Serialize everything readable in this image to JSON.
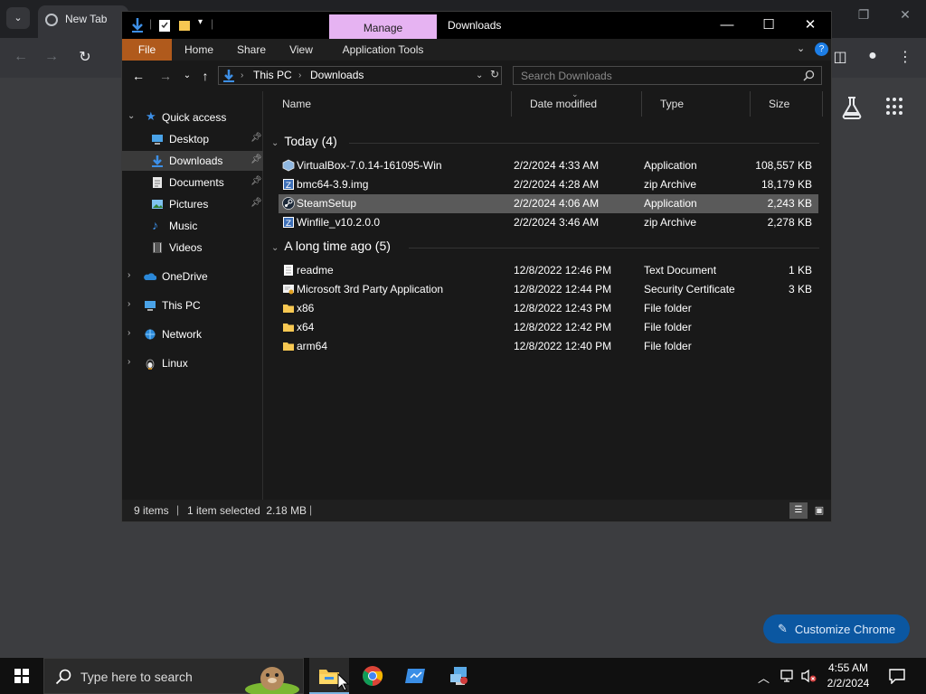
{
  "chrome": {
    "tab_title": "New Tab",
    "customize_label": "Customize Chrome"
  },
  "explorer": {
    "manage_label": "Manage",
    "window_title": "Downloads",
    "ribbon_tabs": [
      "File",
      "Home",
      "Share",
      "View",
      "Application Tools"
    ],
    "address": {
      "segments": [
        "This PC",
        "Downloads"
      ]
    },
    "search_placeholder": "Search Downloads",
    "nav": {
      "quick_access": "Quick access",
      "items": [
        {
          "label": "Desktop",
          "icon": "desktop-icon",
          "pinned": true
        },
        {
          "label": "Downloads",
          "icon": "downloads-icon",
          "pinned": true,
          "selected": true
        },
        {
          "label": "Documents",
          "icon": "documents-icon",
          "pinned": true
        },
        {
          "label": "Pictures",
          "icon": "pictures-icon",
          "pinned": true
        },
        {
          "label": "Music",
          "icon": "music-icon",
          "pinned": false
        },
        {
          "label": "Videos",
          "icon": "videos-icon",
          "pinned": false
        }
      ],
      "roots": [
        "OneDrive",
        "This PC",
        "Network",
        "Linux"
      ]
    },
    "columns": [
      "Name",
      "Date modified",
      "Type",
      "Size"
    ],
    "groups": [
      {
        "label": "Today (4)",
        "rows": [
          {
            "name": "VirtualBox-7.0.14-161095-Win",
            "date": "2/2/2024 4:33 AM",
            "type": "Application",
            "size": "108,557 KB",
            "icon": "installer-icon"
          },
          {
            "name": "bmc64-3.9.img",
            "date": "2/2/2024 4:28 AM",
            "type": "zip Archive",
            "size": "18,179 KB",
            "icon": "zip-icon"
          },
          {
            "name": "SteamSetup",
            "date": "2/2/2024 4:06 AM",
            "type": "Application",
            "size": "2,243 KB",
            "icon": "steam-icon",
            "selected": true
          },
          {
            "name": "Winfile_v10.2.0.0",
            "date": "2/2/2024 3:46 AM",
            "type": "zip Archive",
            "size": "2,278 KB",
            "icon": "zip-icon"
          }
        ]
      },
      {
        "label": "A long time ago (5)",
        "rows": [
          {
            "name": "readme",
            "date": "12/8/2022 12:46 PM",
            "type": "Text Document",
            "size": "1 KB",
            "icon": "text-file-icon"
          },
          {
            "name": "Microsoft 3rd Party Application",
            "date": "12/8/2022 12:44 PM",
            "type": "Security Certificate",
            "size": "3 KB",
            "icon": "certificate-icon"
          },
          {
            "name": "x86",
            "date": "12/8/2022 12:43 PM",
            "type": "File folder",
            "size": "",
            "icon": "folder-icon"
          },
          {
            "name": "x64",
            "date": "12/8/2022 12:42 PM",
            "type": "File folder",
            "size": "",
            "icon": "folder-icon"
          },
          {
            "name": "arm64",
            "date": "12/8/2022 12:40 PM",
            "type": "File folder",
            "size": "",
            "icon": "folder-icon"
          }
        ]
      }
    ],
    "status": {
      "count": "9 items",
      "selection": "1 item selected  2.18 MB"
    }
  },
  "taskbar": {
    "search_placeholder": "Type here to search",
    "time": "4:55 AM",
    "date": "2/2/2024"
  },
  "colors": {
    "accent_file_tab": "#b05a1c",
    "manage_tab": "#e6b3f2",
    "customize_button": "#0b57a1",
    "selection": "#5a5a5a"
  }
}
